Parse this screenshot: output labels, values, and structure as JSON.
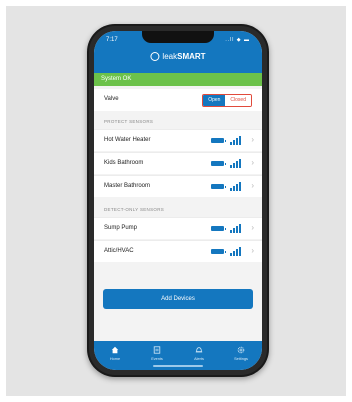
{
  "status": {
    "time": "7:17",
    "icons": "..ll ◆ ▬"
  },
  "app": {
    "logo_prefix": "leak",
    "logo_main": "SMART"
  },
  "system": {
    "status": "System OK"
  },
  "valve": {
    "label": "Valve",
    "open_label": "Open",
    "closed_label": "Closed"
  },
  "protect": {
    "header": "PROTECT SENSORS",
    "sensors": [
      {
        "name": "Hot Water Heater"
      },
      {
        "name": "Kids Bathroom"
      },
      {
        "name": "Master Bathroom"
      }
    ]
  },
  "detect": {
    "header": "DETECT-ONLY SENSORS",
    "sensors": [
      {
        "name": "Sump Pump"
      },
      {
        "name": "Attic/HVAC"
      }
    ]
  },
  "add_button": "Add Devices",
  "tabs": [
    {
      "label": "Home",
      "icon": "home-icon"
    },
    {
      "label": "Events",
      "icon": "events-icon"
    },
    {
      "label": "Alerts",
      "icon": "alerts-icon"
    },
    {
      "label": "Settings",
      "icon": "settings-icon"
    }
  ],
  "colors": {
    "brand": "#1477bf",
    "ok": "#6cc24a",
    "closed": "#e14a3b"
  }
}
